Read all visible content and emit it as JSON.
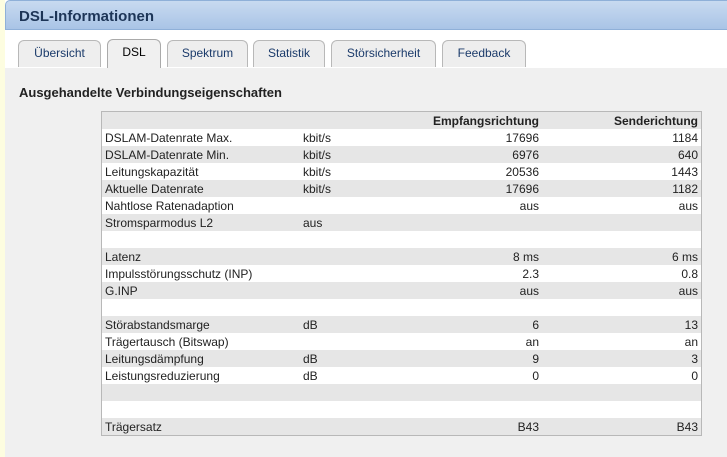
{
  "header": {
    "title": "DSL-Informationen"
  },
  "tabs": [
    {
      "label": "Übersicht",
      "active": false
    },
    {
      "label": "DSL",
      "active": true
    },
    {
      "label": "Spektrum",
      "active": false
    },
    {
      "label": "Statistik",
      "active": false
    },
    {
      "label": "Störsicherheit",
      "active": false
    },
    {
      "label": "Feedback",
      "active": false
    }
  ],
  "section": {
    "title": "Ausgehandelte Verbindungseigenschaften"
  },
  "table": {
    "headers": {
      "label": "",
      "unit": "",
      "down": "Empfangsrichtung",
      "up": "Senderichtung"
    },
    "rows": [
      {
        "label": "DSLAM-Datenrate Max.",
        "unit": "kbit/s",
        "down": "17696",
        "up": "1184"
      },
      {
        "label": "DSLAM-Datenrate Min.",
        "unit": "kbit/s",
        "down": "6976",
        "up": "640"
      },
      {
        "label": "Leitungskapazität",
        "unit": "kbit/s",
        "down": "20536",
        "up": "1443"
      },
      {
        "label": "Aktuelle Datenrate",
        "unit": "kbit/s",
        "down": "17696",
        "up": "1182"
      },
      {
        "label": "Nahtlose Ratenadaption",
        "unit": "",
        "down": "aus",
        "up": "aus"
      },
      {
        "label": "Stromsparmodus L2",
        "unit": "aus",
        "down": "",
        "up": ""
      },
      {
        "label": "",
        "unit": "",
        "down": "",
        "up": ""
      },
      {
        "label": "Latenz",
        "unit": "",
        "down": "8 ms",
        "up": "6 ms"
      },
      {
        "label": "Impulsstörungsschutz (INP)",
        "unit": "",
        "down": "2.3",
        "up": "0.8"
      },
      {
        "label": "G.INP",
        "unit": "",
        "down": "aus",
        "up": "aus"
      },
      {
        "label": "",
        "unit": "",
        "down": "",
        "up": ""
      },
      {
        "label": "Störabstandsmarge",
        "unit": "dB",
        "down": "6",
        "up": "13"
      },
      {
        "label": "Trägertausch (Bitswap)",
        "unit": "",
        "down": "an",
        "up": "an"
      },
      {
        "label": "Leitungsdämpfung",
        "unit": "dB",
        "down": "9",
        "up": "3"
      },
      {
        "label": "Leistungsreduzierung",
        "unit": "dB",
        "down": "0",
        "up": "0"
      },
      {
        "label": "",
        "unit": "",
        "down": "",
        "up": ""
      },
      {
        "label": "",
        "unit": "",
        "down": "",
        "up": ""
      },
      {
        "label": "Trägersatz",
        "unit": "",
        "down": "B43",
        "up": "B43"
      }
    ]
  }
}
